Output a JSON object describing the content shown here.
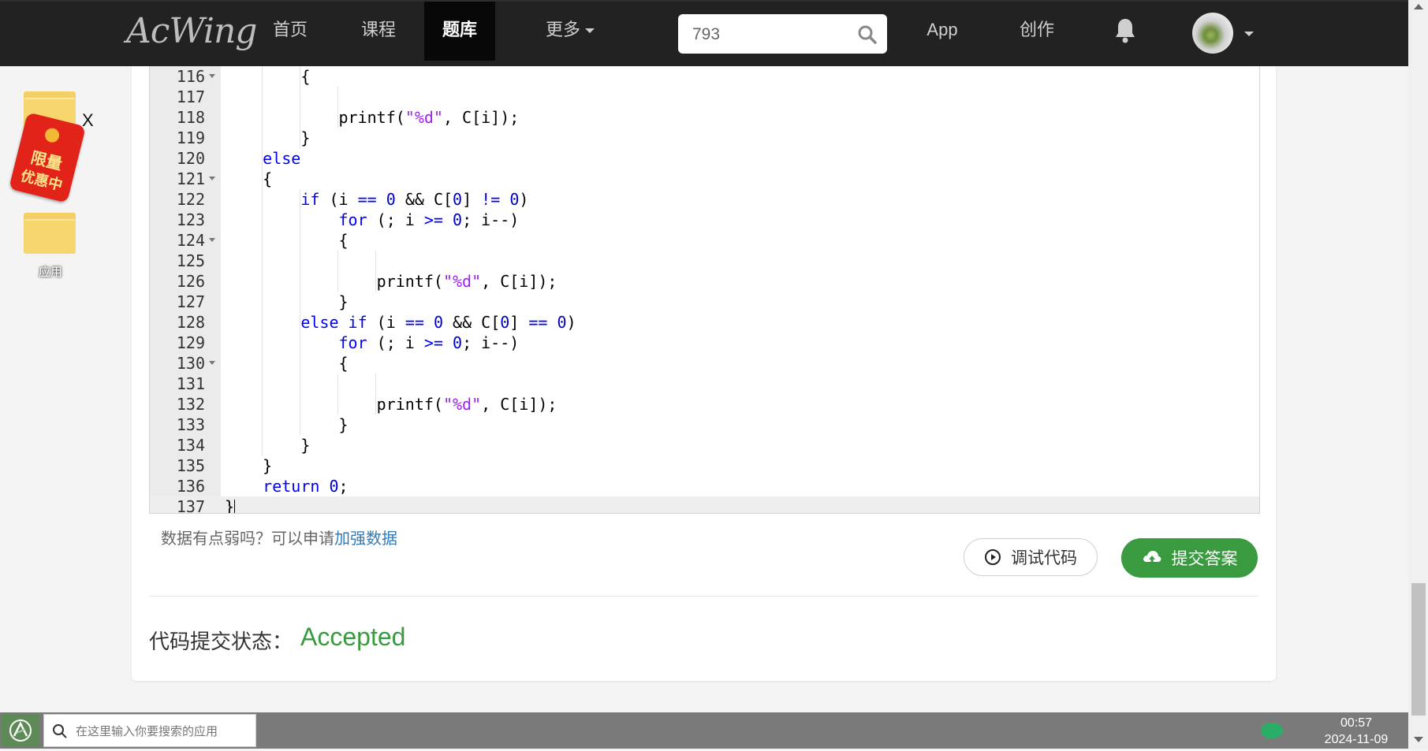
{
  "navbar": {
    "logo": "AcWing",
    "items": [
      "首页",
      "课程",
      "题库",
      "更多"
    ],
    "active_item": "题库",
    "search_value": "793",
    "app_label": "App",
    "create_label": "创作"
  },
  "desktop": {
    "folder_label": "应用",
    "promo_line1": "限量",
    "promo_line2": "优惠中",
    "close_label": "X"
  },
  "editor": {
    "lines": [
      {
        "n": "116",
        "fold": true
      },
      {
        "n": "117",
        "fold": false
      },
      {
        "n": "118",
        "fold": false
      },
      {
        "n": "119",
        "fold": false
      },
      {
        "n": "120",
        "fold": false
      },
      {
        "n": "121",
        "fold": true
      },
      {
        "n": "122",
        "fold": false
      },
      {
        "n": "123",
        "fold": false
      },
      {
        "n": "124",
        "fold": true
      },
      {
        "n": "125",
        "fold": false
      },
      {
        "n": "126",
        "fold": false
      },
      {
        "n": "127",
        "fold": false
      },
      {
        "n": "128",
        "fold": false
      },
      {
        "n": "129",
        "fold": false
      },
      {
        "n": "130",
        "fold": true
      },
      {
        "n": "131",
        "fold": false
      },
      {
        "n": "132",
        "fold": false
      },
      {
        "n": "133",
        "fold": false
      },
      {
        "n": "134",
        "fold": false
      },
      {
        "n": "135",
        "fold": false
      },
      {
        "n": "136",
        "fold": false
      },
      {
        "n": "137",
        "fold": false
      }
    ],
    "active_line": "137"
  },
  "hint": {
    "text": "数据有点弱吗？可以申请",
    "link": "加强数据"
  },
  "buttons": {
    "debug": "调试代码",
    "submit": "提交答案"
  },
  "status": {
    "label": "代码提交状态：",
    "value": "Accepted"
  },
  "taskbar": {
    "search_placeholder": "在这里输入你要搜索的应用",
    "time": "00:57",
    "date": "2024-11-09"
  }
}
